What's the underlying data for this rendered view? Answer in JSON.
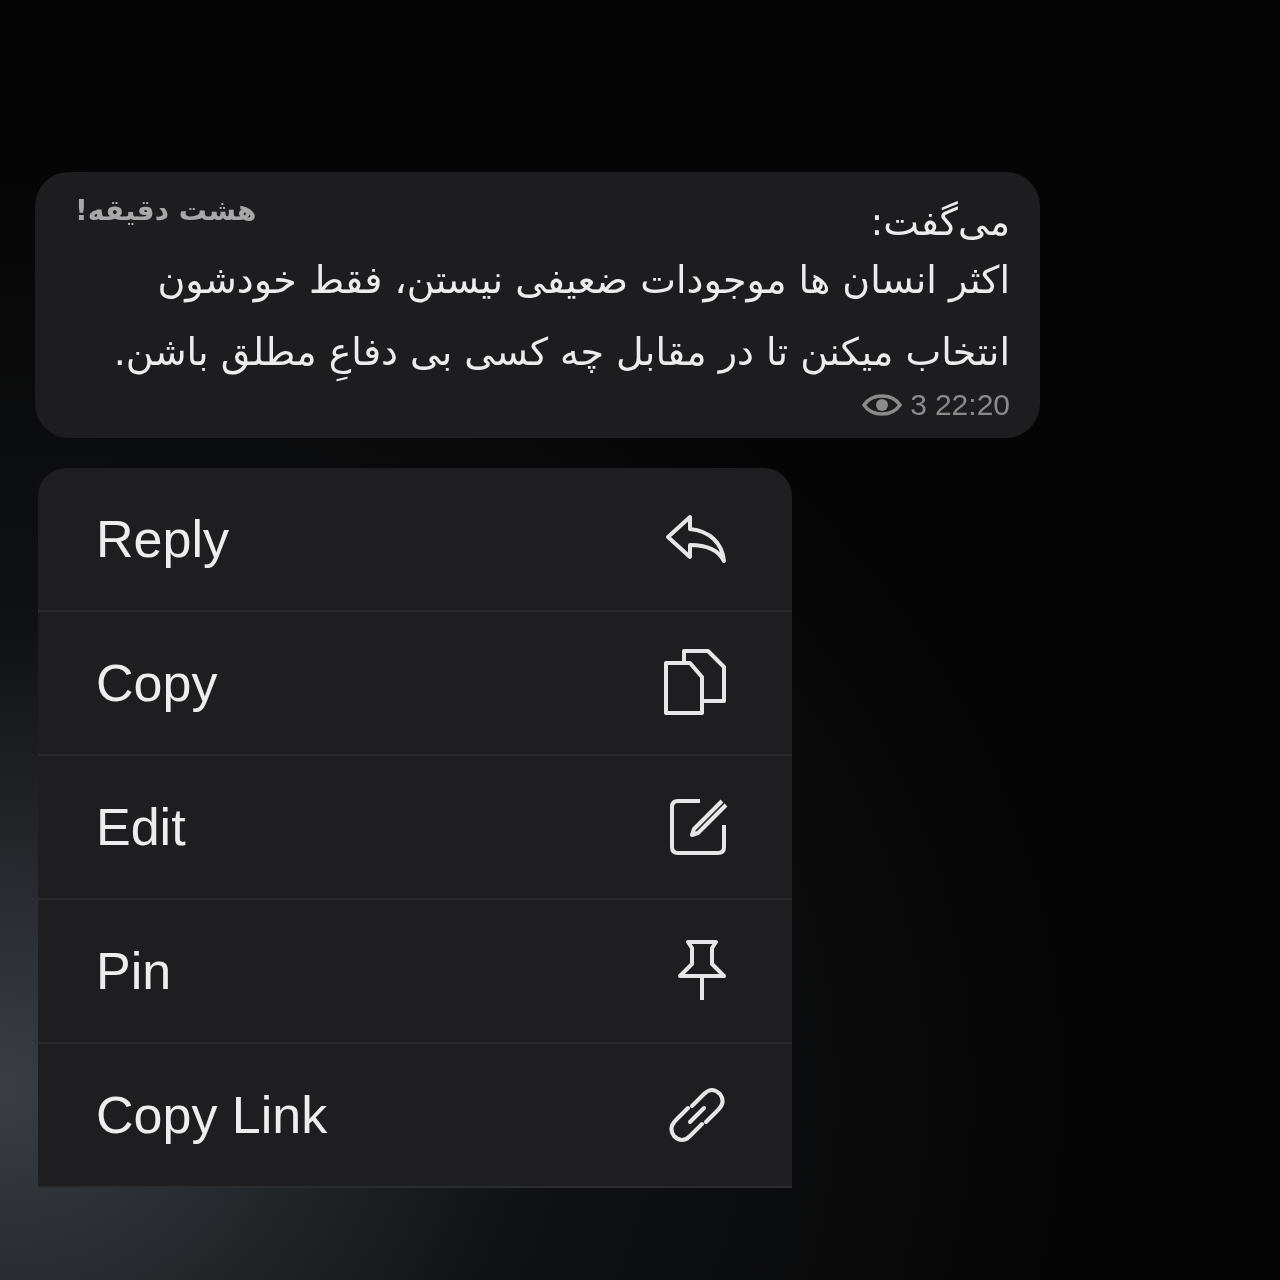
{
  "message": {
    "sender": "هشت دقیقه!",
    "intro": "می‌گفت:",
    "body": "اکثر انسان ها موجودات ضعیفی نیستن، فقط خودشون انتخاب میکنن تا در مقابل چه کسی بی دفاعِ مطلق باشن.",
    "views": "3",
    "time": "22:20"
  },
  "menu": [
    {
      "label": "Reply",
      "kind": "reply"
    },
    {
      "label": "Copy",
      "kind": "copy"
    },
    {
      "label": "Edit",
      "kind": "edit"
    },
    {
      "label": "Pin",
      "kind": "pin"
    },
    {
      "label": "Copy Link",
      "kind": "link"
    }
  ]
}
